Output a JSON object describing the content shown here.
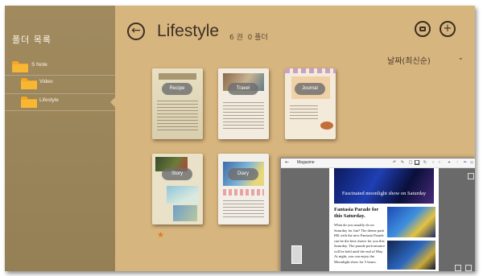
{
  "sidebar": {
    "title": "폴더 목록",
    "items": [
      {
        "label": "S Note"
      },
      {
        "label": "Video"
      },
      {
        "label": "Lifestyle"
      }
    ]
  },
  "header": {
    "title": "Lifestyle",
    "count_text": "6 권  0 폴더",
    "sort_label": "날짜(최신순)"
  },
  "books": [
    {
      "label": "Recipe"
    },
    {
      "label": "Travel"
    },
    {
      "label": "Journal"
    },
    {
      "label": "Story"
    },
    {
      "label": "Diary"
    }
  ],
  "magazine": {
    "window_title": "Magazine",
    "hero_text": "Fascinated moonlight show on Saturday",
    "headline": "Fantasia Parade for this Saturday.",
    "body": "What do you usually do on Saturday for fun? The theme park HK with the new Fantasia Parade can be the best choice for you this Saturday. The parade performance will be held until the end of May. At night, you can enjoy the Moonlight show for 5 hours."
  },
  "colors": {
    "background": "#d7b57f",
    "sidebar": "#9a845a",
    "folder": "#f5a623",
    "accent_star": "#e07b19"
  },
  "icons": [
    "back-arrow-icon",
    "mic-icon",
    "plus-icon",
    "folder-icon",
    "star-icon",
    "chevron-down-icon"
  ]
}
